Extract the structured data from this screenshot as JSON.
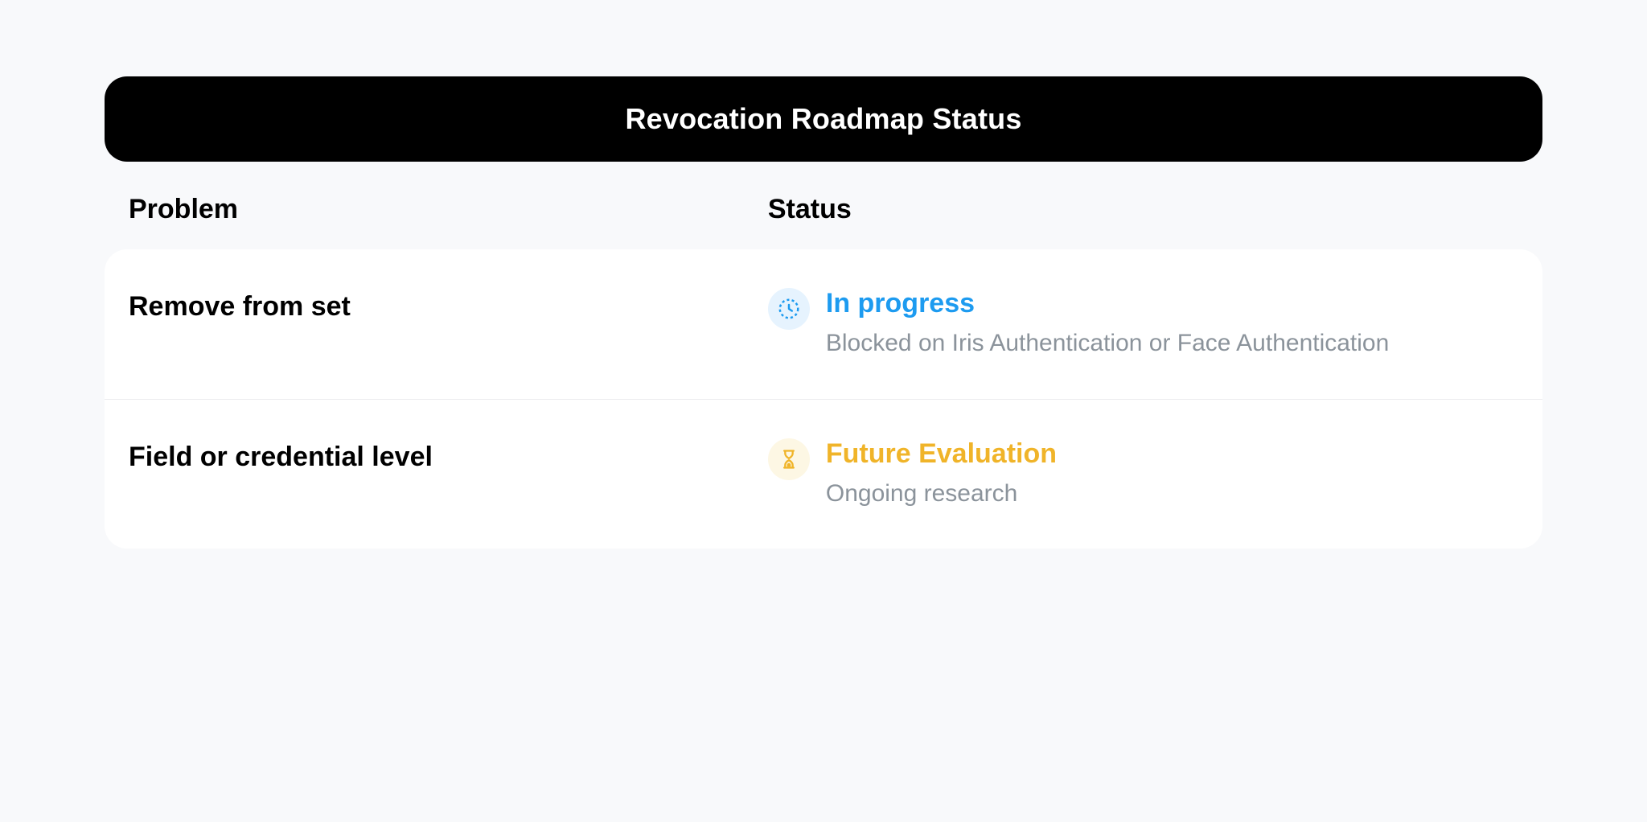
{
  "title": "Revocation Roadmap Status",
  "columns": {
    "problem": "Problem",
    "status": "Status"
  },
  "rows": [
    {
      "problem": "Remove from set",
      "status_title": "In progress",
      "status_sub": "Blocked on Iris Authentication or Face Authentication",
      "status_color": "blue",
      "icon": "clock-dotted-icon"
    },
    {
      "problem": "Field or credential level",
      "status_title": "Future Evaluation",
      "status_sub": "Ongoing research",
      "status_color": "gold",
      "icon": "hourglass-icon"
    }
  ],
  "colors": {
    "blue": "#1d9bf0",
    "gold": "#f0b429",
    "blue_bg": "#e6f3fe",
    "gold_bg": "#fdf7e4",
    "muted": "#8b939b",
    "page_bg": "#f8f9fb"
  }
}
